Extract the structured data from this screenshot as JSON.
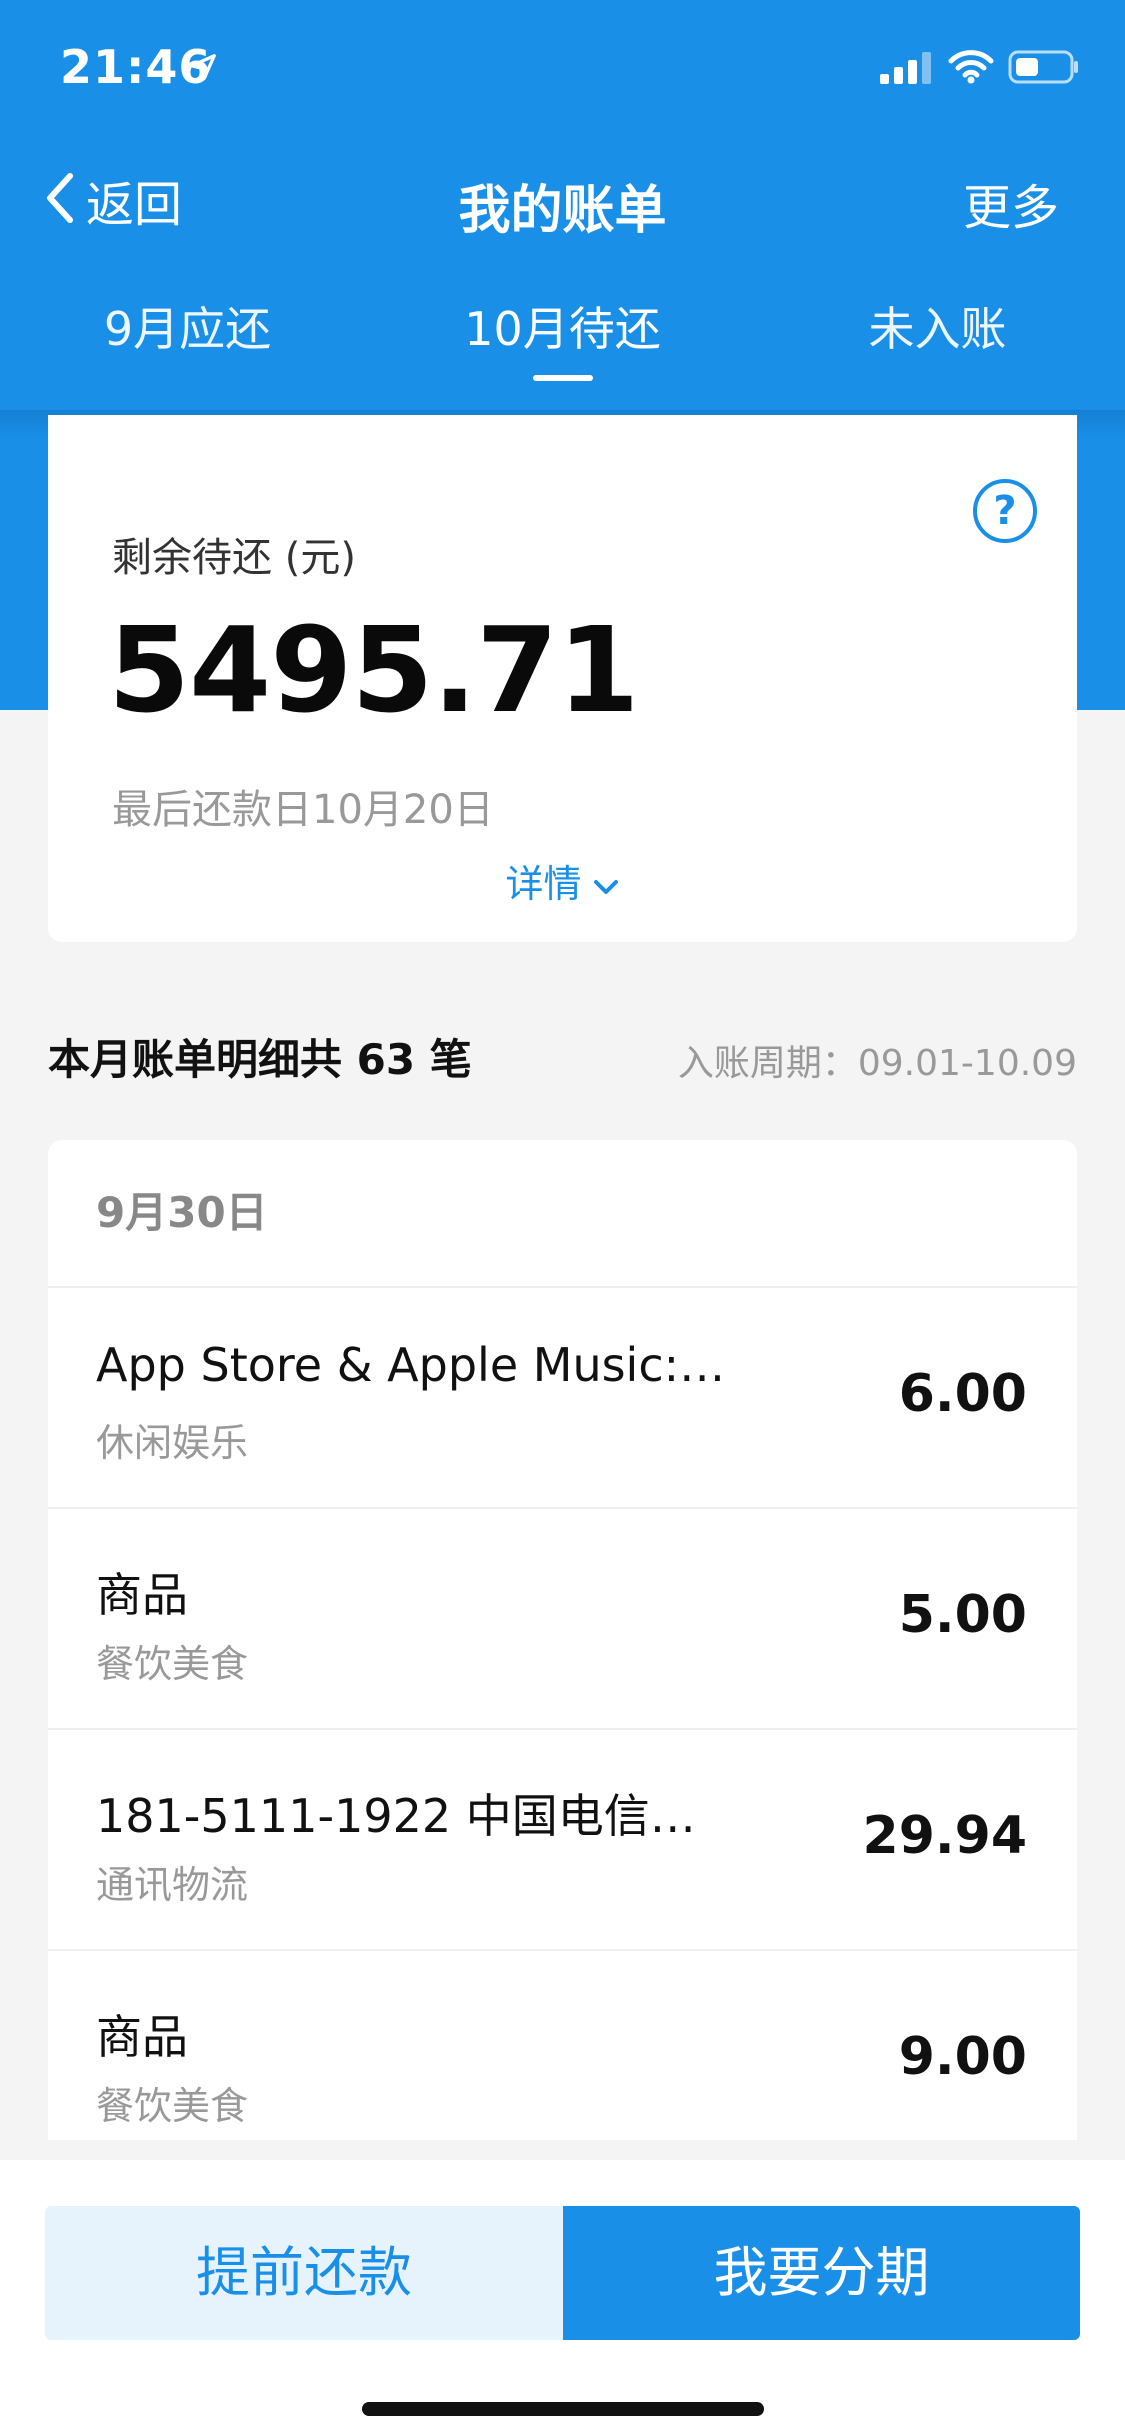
{
  "status_bar": {
    "time": "21:46",
    "icons": [
      "location-arrow-icon",
      "cellular-signal-icon",
      "wifi-icon",
      "battery-icon"
    ]
  },
  "nav": {
    "back_label": "返回",
    "title": "我的账单",
    "more_label": "更多"
  },
  "tabs": [
    {
      "label": "9月应还"
    },
    {
      "label": "10月待还",
      "active": true
    },
    {
      "label": "未入账"
    }
  ],
  "summary": {
    "label": "剩余待还 (元)",
    "amount": "5495.71",
    "due_text": "最后还款日10月20日",
    "detail_label": "详情"
  },
  "statement": {
    "title": "本月账单明细共 63 笔",
    "period": "入账周期：09.01-10.09"
  },
  "transactions": {
    "date": "9月30日",
    "items": [
      {
        "name": "App Store & Apple Music:…",
        "category": "休闲娱乐",
        "amount": "6.00"
      },
      {
        "name": "商品",
        "category": "餐饮美食",
        "amount": "5.00"
      },
      {
        "name": "181-5111-1922 中国电信官…",
        "category": "通讯物流",
        "amount": "29.94"
      },
      {
        "name": "商品",
        "category": "餐饮美食",
        "amount": "9.00"
      }
    ]
  },
  "actions": {
    "prepay_label": "提前还款",
    "installment_label": "我要分期"
  },
  "colors": {
    "brand_blue": "#1a8fe8",
    "light_blue": "#e6f3fd",
    "background": "#f4f4f5"
  }
}
